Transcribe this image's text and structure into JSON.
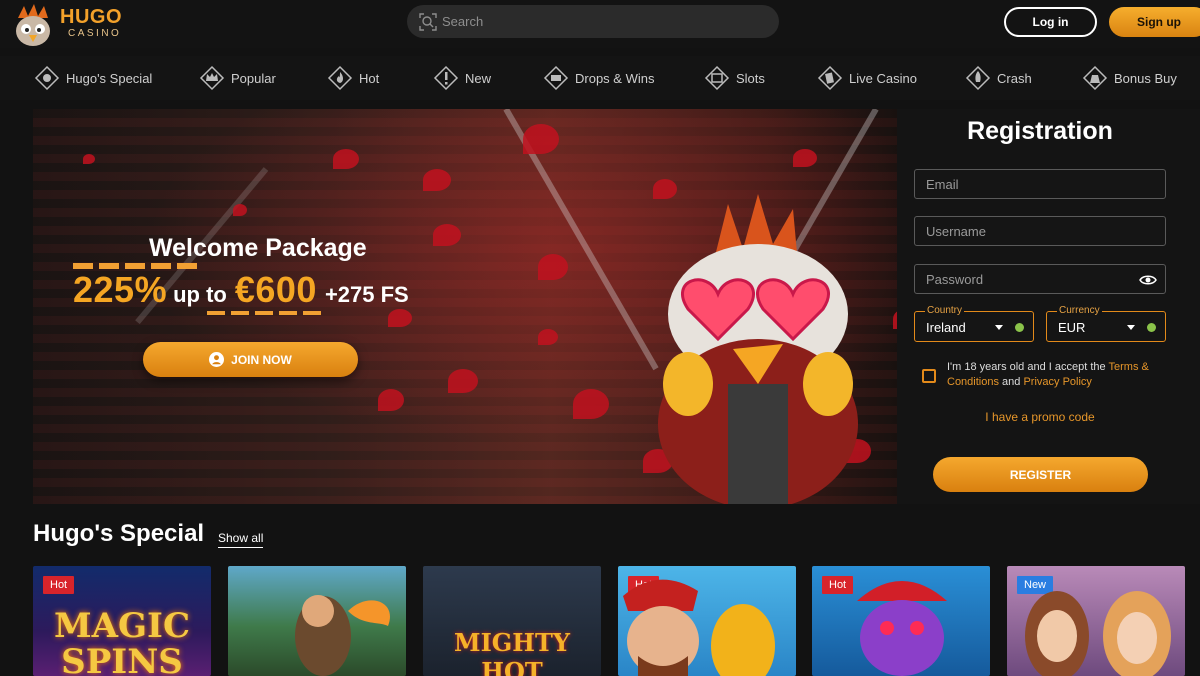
{
  "header": {
    "logo_title": "HUGO",
    "logo_subtitle": "CASINO",
    "search_placeholder": "Search",
    "login_label": "Log in",
    "signup_label": "Sign up"
  },
  "nav": {
    "items": [
      {
        "label": "Hugo's Special",
        "icon": "hugo-special-icon"
      },
      {
        "label": "Popular",
        "icon": "crown-icon"
      },
      {
        "label": "Hot",
        "icon": "flame-icon"
      },
      {
        "label": "New",
        "icon": "exclamation-icon"
      },
      {
        "label": "Drops & Wins",
        "icon": "drops-wins-icon"
      },
      {
        "label": "Slots",
        "icon": "slot-machine-icon"
      },
      {
        "label": "Live Casino",
        "icon": "cards-icon"
      },
      {
        "label": "Crash",
        "icon": "rocket-icon"
      },
      {
        "label": "Bonus Buy",
        "icon": "bonus-bag-icon"
      }
    ]
  },
  "hero": {
    "title": "Welcome Package",
    "percent": "225%",
    "up_to": "up to",
    "amount": "€600",
    "free_spins": "+275 FS",
    "join_label": "JOIN NOW"
  },
  "registration": {
    "title": "Registration",
    "email_placeholder": "Email",
    "username_placeholder": "Username",
    "password_placeholder": "Password",
    "country_label": "Country",
    "country_value": "Ireland",
    "currency_label": "Currency",
    "currency_value": "EUR",
    "terms_prefix": "I'm 18 years old and I accept the ",
    "terms_link": "Terms & Conditions",
    "terms_and": " and ",
    "privacy_link": "Privacy Policy",
    "promo_label": "I have a promo code",
    "register_label": "REGISTER"
  },
  "section": {
    "title": "Hugo's Special",
    "show_all": "Show all",
    "games": [
      {
        "badge": "Hot",
        "badge_type": "hot",
        "title": "MAGIC SPINS"
      },
      {
        "badge": "",
        "badge_type": "",
        "title": ""
      },
      {
        "badge": "",
        "badge_type": "",
        "title": "MIGHTY HOT"
      },
      {
        "badge": "Hot",
        "badge_type": "hot",
        "title": ""
      },
      {
        "badge": "Hot",
        "badge_type": "hot",
        "title": ""
      },
      {
        "badge": "New",
        "badge_type": "new",
        "title": ""
      }
    ]
  },
  "colors": {
    "accent": "#f5a623",
    "background": "#121212",
    "hot_badge": "#d8242b",
    "new_badge": "#2a7de1"
  }
}
